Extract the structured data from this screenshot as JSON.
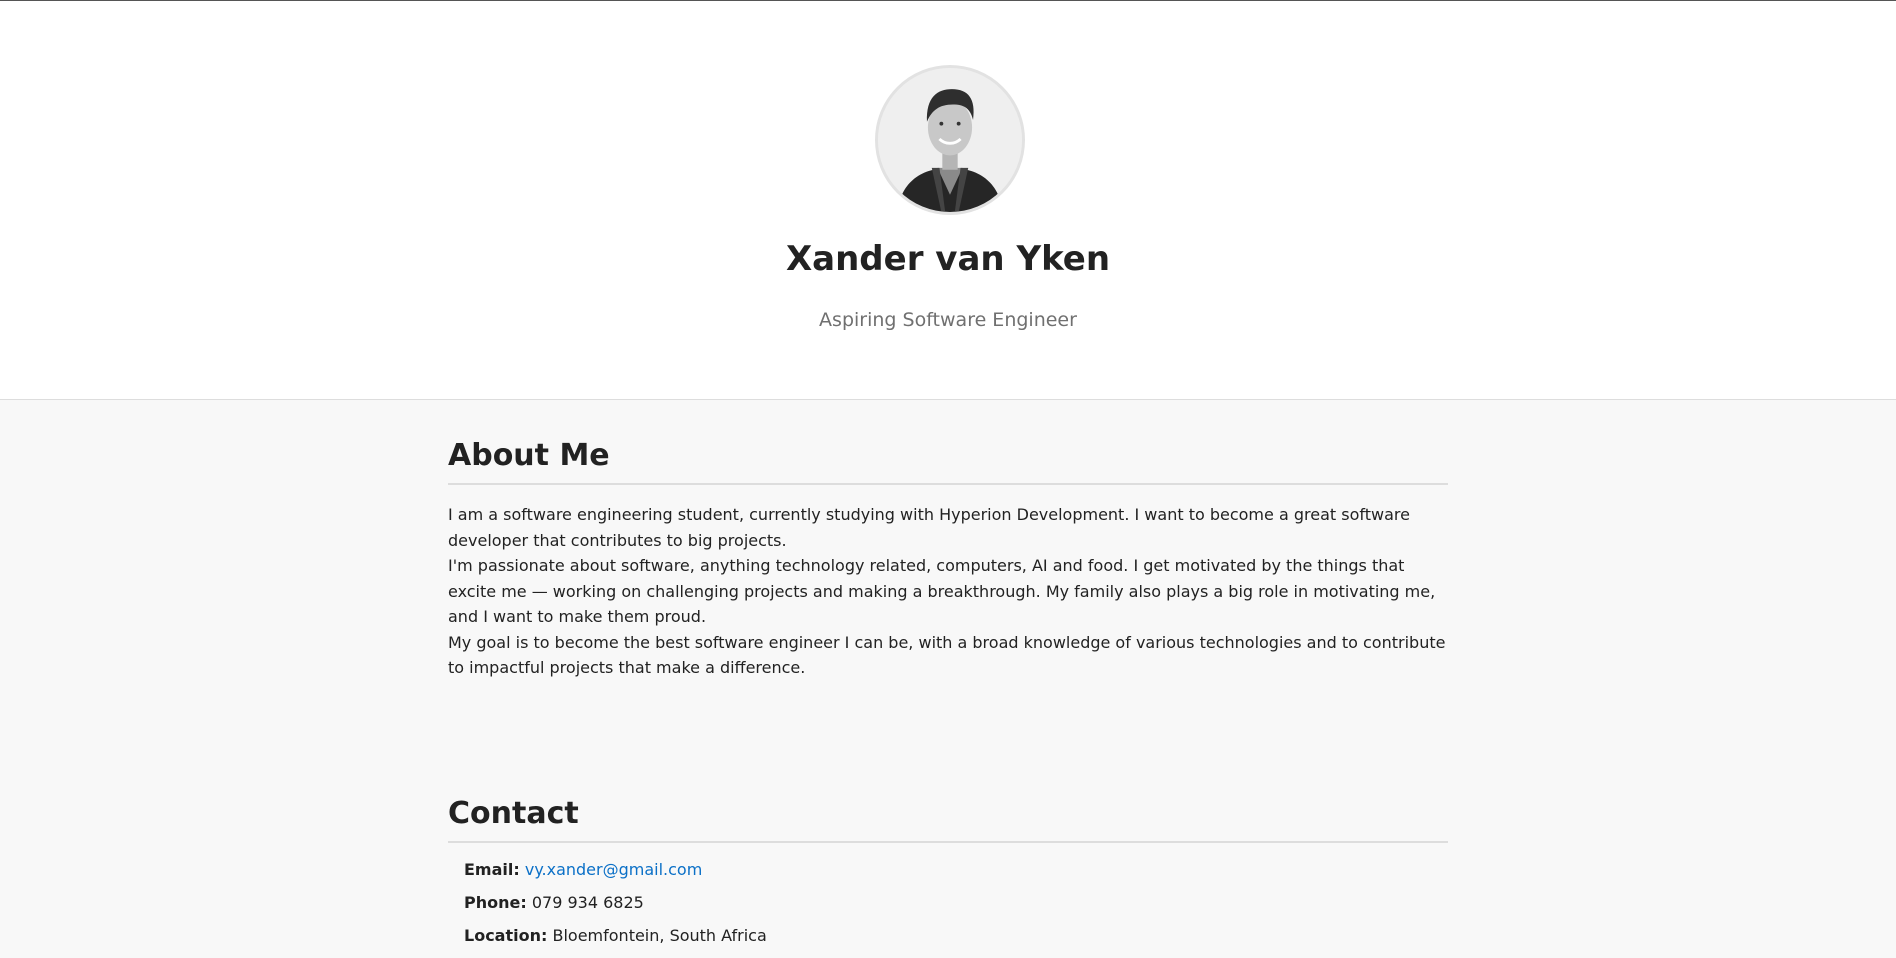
{
  "profile": {
    "name": "Xander van Yken",
    "subtitle": "Aspiring Software Engineer",
    "avatar_icon": "profile-photo"
  },
  "about": {
    "heading": "About Me",
    "paragraphs": [
      "I am a software engineering student, currently studying with Hyperion Development. I want to become a great software developer that contributes to big projects.",
      "I'm passionate about software, anything technology related, computers, AI and food. I get motivated by the things that excite me — working on challenging projects and making a breakthrough. My family also plays a big role in motivating me, and I want to make them proud.",
      "My goal is to become the best software engineer I can be, with a broad knowledge of various technologies and to contribute to impactful projects that make a difference."
    ]
  },
  "contact": {
    "heading": "Contact",
    "email_label": "Email:",
    "email": "vy.xander@gmail.com",
    "email_href": "mailto:vy.xander@gmail.com",
    "phone_label": "Phone:",
    "phone": "079 934 6825",
    "location_label": "Location:",
    "location": "Bloemfontein, South Africa"
  },
  "colors": {
    "link": "#0b70c7",
    "text": "#222222",
    "muted": "#707070",
    "page_background": "#f8f8f8",
    "header_background": "#ffffff"
  }
}
